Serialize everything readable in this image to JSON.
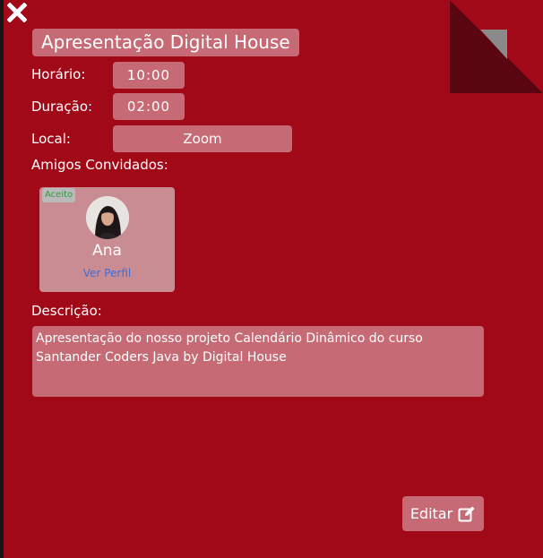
{
  "event": {
    "title": "Apresentação Digital House",
    "time_label": "Horário:",
    "time_value": "10:00",
    "duration_label": "Duração:",
    "duration_value": "02:00",
    "location_label": "Local:",
    "location_value": "Zoom",
    "friends_label": "Amigos Convidados:",
    "description_label": "Descrição:",
    "description_text": "Apresentação do nosso projeto Calendário Dinâmico do curso Santander Coders Java by Digital House"
  },
  "friends": [
    {
      "status": "Aceito",
      "name": "Ana",
      "profile_link": "Ver Perfil"
    }
  ],
  "actions": {
    "edit_label": "Editar"
  },
  "icons": {
    "close": "close-icon",
    "edit": "edit-icon"
  },
  "colors": {
    "background": "#a10918",
    "field": "#c66b75",
    "friend_card": "#c98c92",
    "accepted": "#2e9e3e",
    "link": "#3b6fd6"
  }
}
